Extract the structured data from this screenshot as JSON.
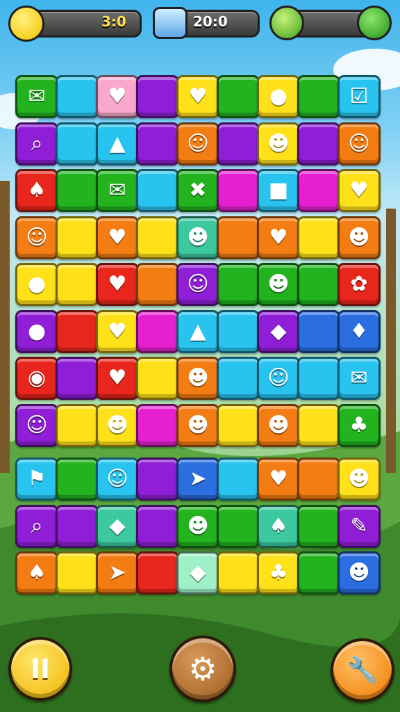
{
  "hud": {
    "moves": {
      "icon": "bird-icon",
      "value": "3:0"
    },
    "timer": {
      "icon": "player-avatar-icon",
      "value": "20:0"
    },
    "meter": {
      "icon": "lollipop-icon",
      "end_icon": "wrench-icon",
      "fill": 0.0
    }
  },
  "palette": {
    "G": "#22b31f",
    "C": "#29c3ef",
    "P": "#8f1ed6",
    "Y": "#ffe11a",
    "O": "#f47d13",
    "R": "#e8261c",
    "M": "#e420cf",
    "B": "#2a6ee0",
    "K": "#f7a8cc",
    "L": "#3cc9a0",
    "N": "#9ff0c8"
  },
  "board": {
    "rows": [
      [
        {
          "c": "G",
          "icon": "envelope-icon",
          "g": "✉"
        },
        {
          "c": "C"
        },
        {
          "c": "K",
          "icon": "heart-icon",
          "g": "♥"
        },
        {
          "c": "P"
        },
        {
          "c": "Y",
          "icon": "heart-icon",
          "g": "♥"
        },
        {
          "c": "G"
        },
        {
          "c": "Y",
          "icon": "green-ball-icon",
          "g": "●"
        },
        {
          "c": "G"
        },
        {
          "c": "C",
          "icon": "checkbox-icon",
          "g": "☑"
        }
      ],
      [
        {
          "c": "P",
          "icon": "magnifier-icon",
          "g": "⌕"
        },
        {
          "c": "C"
        },
        {
          "c": "C",
          "icon": "warning-triangle-icon",
          "g": "▲"
        },
        {
          "c": "P"
        },
        {
          "c": "O",
          "icon": "boy-face-icon",
          "g": "☺"
        },
        {
          "c": "P"
        },
        {
          "c": "Y",
          "icon": "alien-face-icon",
          "g": "☻"
        },
        {
          "c": "P"
        },
        {
          "c": "O",
          "icon": "ghost-icon",
          "g": "☺"
        }
      ],
      [
        {
          "c": "R",
          "icon": "leaf-icon",
          "g": "♠"
        },
        {
          "c": "G"
        },
        {
          "c": "G",
          "icon": "envelope-icon",
          "g": "✉"
        },
        {
          "c": "C"
        },
        {
          "c": "G",
          "icon": "cross-icon",
          "g": "✖"
        },
        {
          "c": "M"
        },
        {
          "c": "C",
          "icon": "gem-icon",
          "g": "■"
        },
        {
          "c": "M"
        },
        {
          "c": "Y",
          "icon": "heart-icon",
          "g": "♥"
        }
      ],
      [
        {
          "c": "O",
          "icon": "face-icon",
          "g": "☺"
        },
        {
          "c": "Y"
        },
        {
          "c": "O",
          "icon": "heart-icon",
          "g": "♥"
        },
        {
          "c": "Y"
        },
        {
          "c": "L",
          "icon": "chick-icon",
          "g": "☻"
        },
        {
          "c": "O"
        },
        {
          "c": "O",
          "icon": "heart-icon",
          "g": "♥"
        },
        {
          "c": "Y"
        },
        {
          "c": "O",
          "icon": "duck-icon",
          "g": "☻"
        }
      ],
      [
        {
          "c": "Y",
          "icon": "blue-orb-icon",
          "g": "●"
        },
        {
          "c": "Y"
        },
        {
          "c": "R",
          "icon": "shell-icon",
          "g": "♥"
        },
        {
          "c": "O"
        },
        {
          "c": "P",
          "icon": "face-icon",
          "g": "☺"
        },
        {
          "c": "G"
        },
        {
          "c": "G",
          "icon": "goblin-face-icon",
          "g": "☻"
        },
        {
          "c": "G"
        },
        {
          "c": "R",
          "icon": "flower-icon",
          "g": "✿"
        }
      ],
      [
        {
          "c": "P",
          "icon": "blue-orb-icon",
          "g": "●"
        },
        {
          "c": "R"
        },
        {
          "c": "Y",
          "icon": "heart-icon",
          "g": "♥"
        },
        {
          "c": "M"
        },
        {
          "c": "C",
          "icon": "warning-triangle-icon",
          "g": "▲"
        },
        {
          "c": "C"
        },
        {
          "c": "P",
          "icon": "green-gem-icon",
          "g": "◆"
        },
        {
          "c": "B"
        },
        {
          "c": "B",
          "icon": "water-drop-icon",
          "g": "♦"
        }
      ],
      [
        {
          "c": "R",
          "icon": "fish-icon",
          "g": "◉"
        },
        {
          "c": "P"
        },
        {
          "c": "R",
          "icon": "heart-icon",
          "g": "♥"
        },
        {
          "c": "Y"
        },
        {
          "c": "O",
          "icon": "chick-icon",
          "g": "☻"
        },
        {
          "c": "C"
        },
        {
          "c": "C",
          "icon": "face-icon",
          "g": "☺"
        },
        {
          "c": "C"
        },
        {
          "c": "C",
          "icon": "envelope-icon",
          "g": "✉"
        }
      ],
      [
        {
          "c": "P",
          "icon": "girl-face-icon",
          "g": "☺"
        },
        {
          "c": "Y"
        },
        {
          "c": "Y",
          "icon": "green-blob-icon",
          "g": "☻"
        },
        {
          "c": "M"
        },
        {
          "c": "O",
          "icon": "cat-icon",
          "g": "☻"
        },
        {
          "c": "Y"
        },
        {
          "c": "O",
          "icon": "alien-face-icon",
          "g": "☻"
        },
        {
          "c": "Y"
        },
        {
          "c": "G",
          "icon": "drumstick-icon",
          "g": "♣"
        }
      ],
      [
        {
          "c": "C",
          "icon": "flag-icon",
          "g": "⚑"
        },
        {
          "c": "G"
        },
        {
          "c": "C",
          "icon": "face-icon",
          "g": "☺"
        },
        {
          "c": "P"
        },
        {
          "c": "B",
          "icon": "paper-plane-icon",
          "g": "➤"
        },
        {
          "c": "C"
        },
        {
          "c": "O",
          "icon": "heart-key-icon",
          "g": "♥"
        },
        {
          "c": "O"
        },
        {
          "c": "Y",
          "icon": "owl-icon",
          "g": "☻"
        }
      ],
      [
        {
          "c": "P",
          "icon": "magnifier-icon",
          "g": "⌕"
        },
        {
          "c": "P"
        },
        {
          "c": "L",
          "icon": "eraser-icon",
          "g": "◆"
        },
        {
          "c": "P"
        },
        {
          "c": "G",
          "icon": "chick-icon",
          "g": "☻"
        },
        {
          "c": "G"
        },
        {
          "c": "L",
          "icon": "leaf-icon",
          "g": "♠"
        },
        {
          "c": "G"
        },
        {
          "c": "P",
          "icon": "note-icon",
          "g": "✎"
        }
      ],
      [
        {
          "c": "O",
          "icon": "leaf-icon",
          "g": "♠"
        },
        {
          "c": "Y"
        },
        {
          "c": "O",
          "icon": "paper-plane-icon",
          "g": "➤"
        },
        {
          "c": "R"
        },
        {
          "c": "N",
          "icon": "eraser-icon",
          "g": "◆"
        },
        {
          "c": "Y"
        },
        {
          "c": "Y",
          "icon": "bunny-icon",
          "g": "♣"
        },
        {
          "c": "G"
        },
        {
          "c": "B",
          "icon": "alien-face-icon",
          "g": "☻"
        }
      ]
    ]
  },
  "bottom": {
    "pause": {
      "icon": "pause-icon",
      "label": "II"
    },
    "settings": {
      "icon": "gear-icon",
      "label": "⚙"
    },
    "tool": {
      "icon": "wrench-icon",
      "label": "🔧"
    }
  }
}
